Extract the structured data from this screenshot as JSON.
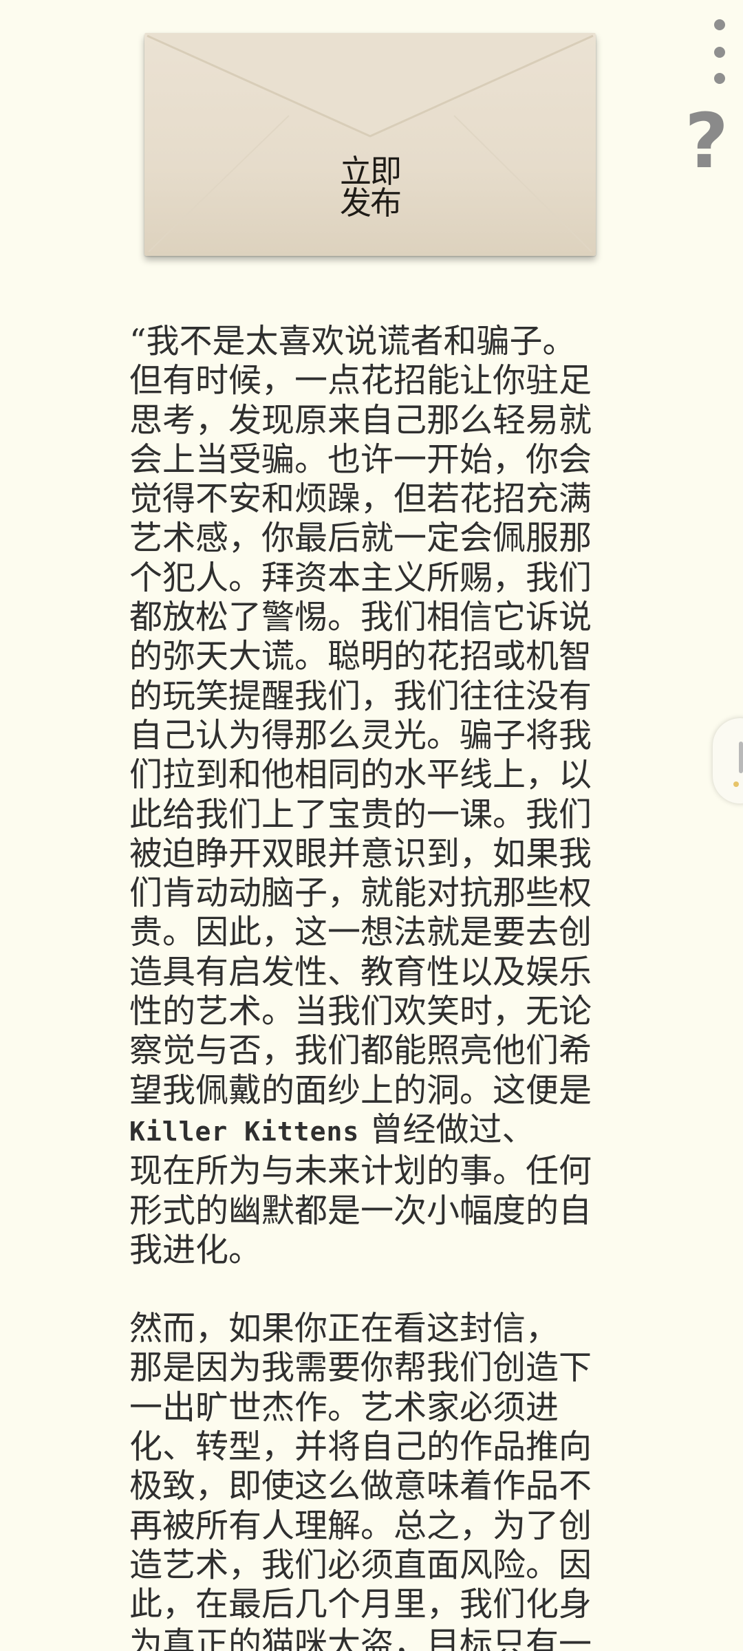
{
  "envelope": {
    "seal_line1": "立即",
    "seal_line2": "发布"
  },
  "toolbar": {
    "menu_icon": "more-vertical-icon",
    "help_icon": "question-mark-icon",
    "help_glyph": "?"
  },
  "side_panel": {
    "icon": "drawer-handle-icon"
  },
  "letter": {
    "p1_before": "“我不是太喜欢说谎者和骗子。\n但有时候，一点花招能让你驻足\n思考，发现原来自己那么轻易就\n会上当受骗。也许一开始，你会\n觉得不安和烦躁，但若花招充满\n艺术感，你最后就一定会佩服那\n个犯人。拜资本主义所赐，我们\n都放松了警惕。我们相信它诉说\n的弥天大谎。聪明的花招或机智\n的玩笑提醒我们，我们往往没有\n自己认为得那么灵光。骗子将我\n们拉到和他相同的水平线上，以\n此给我们上了宝贵的一课。我们\n被迫睁开双眼并意识到，如果我\n们肯动动脑子，就能对抗那些权\n贵。因此，这一想法就是要去创\n造具有启发性、教育性以及娱乐\n性的艺术。当我们欢笑时，无论\n察觉与否，我们都能照亮他们希\n望我佩戴的面纱上的洞。这便是\n",
    "brand": "Killer Kittens",
    "p1_after": " 曾经做过、\n现在所为与未来计划的事。任何\n形式的幽默都是一次小幅度的自\n我进化。",
    "p2": "  然而，如果你正在看这封信，\n那是因为我需要你帮我们创造下\n一出旷世杰作。艺术家必须进\n化、转型，并将自己的作品推向\n极致，即使这么做意味着作品不\n再被所有人理解。总之，为了创\n造艺术，我们必须直面风险。因\n此，在最后几个月里，我们化身\n为真正的猫咪大盗，目标只有一"
  }
}
